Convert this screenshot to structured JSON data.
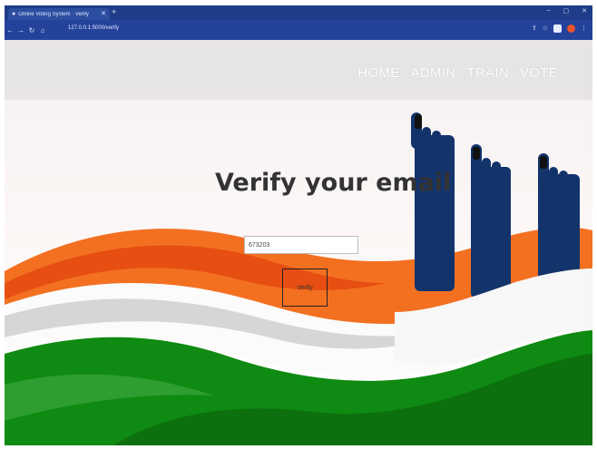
{
  "browser": {
    "tab_title": "Online Voting System · Verify",
    "new_tab": "+",
    "url": "127.0.0.1:5000/verify"
  },
  "nav": {
    "items": [
      "HOME",
      "ADMIN",
      "TRAIN",
      "VOTE"
    ]
  },
  "main": {
    "title": "Verify your email",
    "code_value": "673203",
    "verify_label": "Verify"
  },
  "colors": {
    "saffron": "#f37021",
    "green": "#138808",
    "navy": "#13336b"
  }
}
